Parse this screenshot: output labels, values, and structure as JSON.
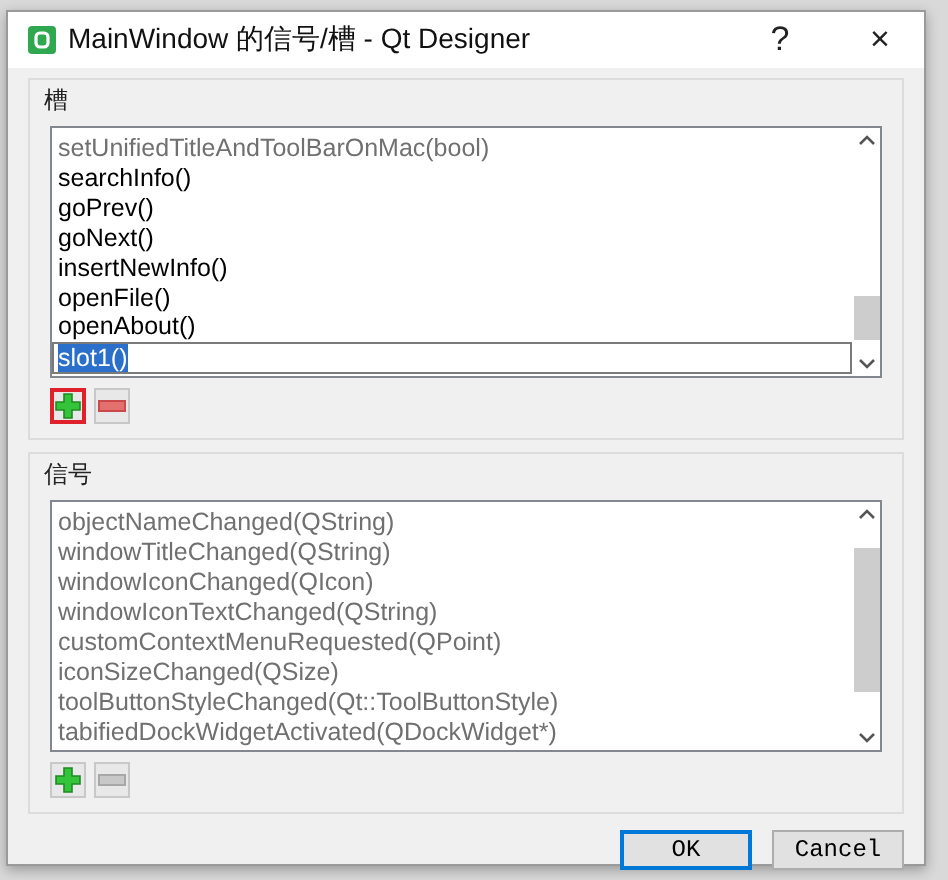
{
  "window": {
    "title": "MainWindow 的信号/槽 - Qt Designer",
    "buttons": [
      "?",
      "×"
    ]
  },
  "slots": {
    "title": "槽",
    "items": [
      {
        "text": "setUnifiedTitleAndToolBarOnMac(bool)",
        "inherited": true,
        "editing": false
      },
      {
        "text": "searchInfo()",
        "inherited": false,
        "editing": false
      },
      {
        "text": "goPrev()",
        "inherited": false,
        "editing": false
      },
      {
        "text": "goNext()",
        "inherited": false,
        "editing": false
      },
      {
        "text": "insertNewInfo()",
        "inherited": false,
        "editing": false
      },
      {
        "text": "openFile()",
        "inherited": false,
        "editing": false
      },
      {
        "text": "openAbout()",
        "inherited": false,
        "editing": false
      },
      {
        "text": "slot1()",
        "inherited": false,
        "editing": true
      }
    ],
    "tools": [
      {
        "kind": "add",
        "disabled": false,
        "highlighted": true
      },
      {
        "kind": "remove",
        "disabled": false,
        "highlighted": false
      }
    ]
  },
  "signals": {
    "title": "信号",
    "items": [
      {
        "text": "objectNameChanged(QString)",
        "inherited": true,
        "editing": false
      },
      {
        "text": "windowTitleChanged(QString)",
        "inherited": true,
        "editing": false
      },
      {
        "text": "windowIconChanged(QIcon)",
        "inherited": true,
        "editing": false
      },
      {
        "text": "windowIconTextChanged(QString)",
        "inherited": true,
        "editing": false
      },
      {
        "text": "customContextMenuRequested(QPoint)",
        "inherited": true,
        "editing": false
      },
      {
        "text": "iconSizeChanged(QSize)",
        "inherited": true,
        "editing": false
      },
      {
        "text": "toolButtonStyleChanged(Qt::ToolButtonStyle)",
        "inherited": true,
        "editing": false
      },
      {
        "text": "tabifiedDockWidgetActivated(QDockWidget*)",
        "inherited": true,
        "editing": false
      }
    ],
    "tools": [
      {
        "kind": "add",
        "disabled": false,
        "highlighted": false
      },
      {
        "kind": "remove",
        "disabled": true,
        "highlighted": false
      }
    ]
  },
  "buttons": [
    {
      "label": "OK",
      "default": true
    },
    {
      "label": "Cancel",
      "default": false
    }
  ]
}
